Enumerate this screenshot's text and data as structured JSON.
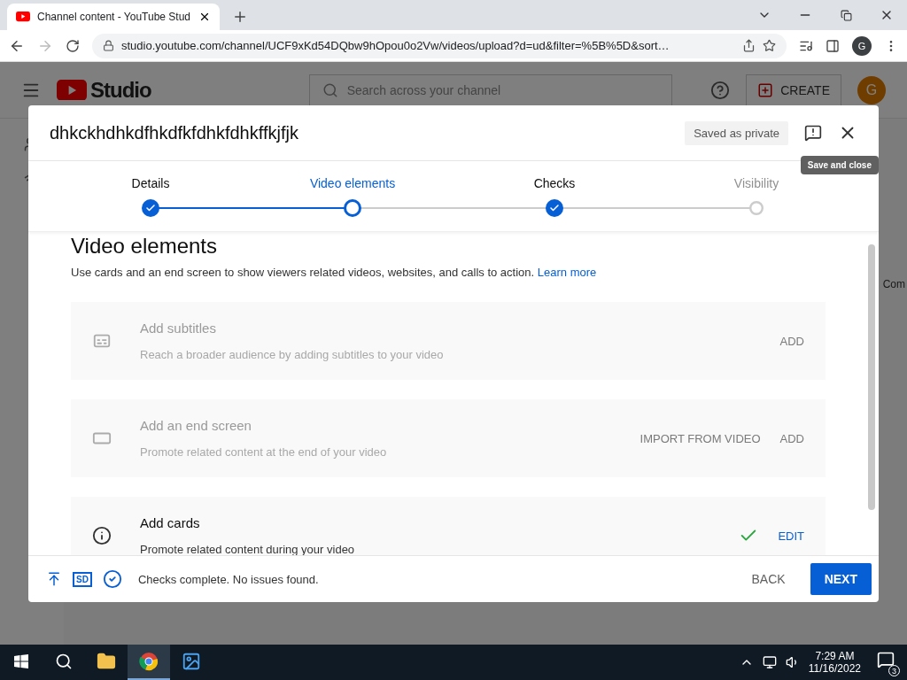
{
  "browser": {
    "tab_title": "Channel content - YouTube Stud",
    "url": "studio.youtube.com/channel/UCF9xKd54DQbw9hOpou0o2Vw/videos/upload?d=ud&filter=%5B%5D&sort…",
    "profile": "G"
  },
  "studio": {
    "logo_text": "Studio",
    "search_placeholder": "Search across your channel",
    "create_label": "CREATE",
    "avatar": "G",
    "column_text": "Com"
  },
  "dialog": {
    "title": "dhkckhdhkdfhkdfkfdhkfdhkffkjfjk",
    "saved_status": "Saved as private",
    "tooltip": "Save and close",
    "steps": [
      {
        "label": "Details",
        "done": true,
        "selected": false
      },
      {
        "label": "Video elements",
        "done": false,
        "selected": true
      },
      {
        "label": "Checks",
        "done": true,
        "selected": false
      },
      {
        "label": "Visibility",
        "done": false,
        "selected": false
      }
    ],
    "heading": "Video elements",
    "description": "Use cards and an end screen to show viewers related videos, websites, and calls to action.",
    "learn_more": "Learn more",
    "elements": [
      {
        "kind": "subtitles",
        "title": "Add subtitles",
        "description": "Reach a broader audience by adding subtitles to your video",
        "disabled": true,
        "completed": false,
        "actions": [
          "ADD"
        ]
      },
      {
        "kind": "end_screen",
        "title": "Add an end screen",
        "description": "Promote related content at the end of your video",
        "disabled": true,
        "completed": false,
        "actions": [
          "IMPORT FROM VIDEO",
          "ADD"
        ]
      },
      {
        "kind": "cards",
        "title": "Add cards",
        "description": "Promote related content during your video",
        "disabled": false,
        "completed": true,
        "actions": [
          "EDIT"
        ]
      }
    ],
    "footer": {
      "quality": "SD",
      "status": "Checks complete. No issues found.",
      "back": "BACK",
      "next": "NEXT"
    }
  },
  "taskbar": {
    "apps": [
      {
        "kind": "explorer",
        "selected": false
      },
      {
        "kind": "chrome",
        "selected": true
      },
      {
        "kind": "photos",
        "selected": false
      }
    ],
    "time": "7:29 AM",
    "date": "11/16/2022",
    "notifications": "3"
  }
}
